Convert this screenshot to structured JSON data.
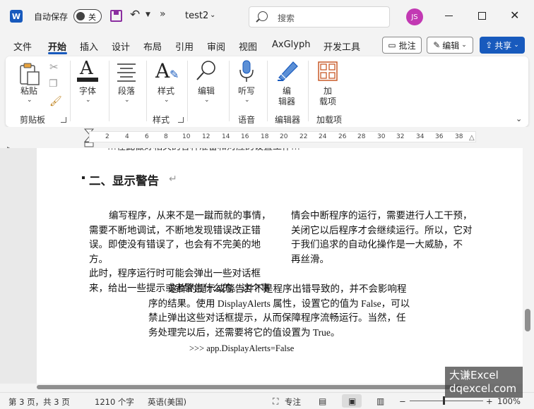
{
  "titlebar": {
    "app_letter": "W",
    "autosave_label": "自动保存",
    "autosave_state": "关",
    "doc_title": "test2",
    "search_placeholder": "搜索",
    "avatar_initials": "JS",
    "more": "»"
  },
  "menu": {
    "tabs": [
      "文件",
      "开始",
      "插入",
      "设计",
      "布局",
      "引用",
      "审阅",
      "视图",
      "AxGlyph",
      "开发工具"
    ],
    "active_tab": "开始",
    "comment_label": "批注",
    "edit_label": "编辑",
    "share_label": "共享"
  },
  "ribbon": {
    "paste_label": "粘贴",
    "clipboard_group": "剪贴板",
    "font_label": "字体",
    "paragraph_label": "段落",
    "styles_label": "样式",
    "styles_group": "样式",
    "editing_label": "编辑",
    "dictate_label": "听写",
    "voice_group": "语音",
    "editor_label_1": "编",
    "editor_label_2": "辑器",
    "editor_group": "编辑器",
    "addins_label_1": "加",
    "addins_label_2": "载项",
    "addins_group": "加载项"
  },
  "ruler_ticks": [
    "2",
    "4",
    "6",
    "8",
    "10",
    "12",
    "14",
    "16",
    "18",
    "20",
    "22",
    "24",
    "26",
    "28",
    "30",
    "32",
    "34",
    "36",
    "38"
  ],
  "document": {
    "cut_line": "…在此做好相关的各种准备和对应的设置工作…",
    "heading": "二、显示警告",
    "left_col": [
      "编写程序，从来不是一蹴而就的事情，",
      "需要不断地调试，不断地发现错误改正错",
      "误。即使没有错误了，也会有不完美的地方。",
      "此时，程序运行时可能会弹出一些对话框",
      "来，给出一些提示或者警告什么的。这个事"
    ],
    "right_col": [
      "情会中断程序的运行，需要进行人工干预，",
      "关闭它以后程序才会继续运行。所以，它对",
      "于我们追求的自动化操作是一大威胁，不",
      "再丝滑。"
    ],
    "center_block": [
      "这样的提示或警告并不是程序出错导致的，并不会影响程",
      "序的结果。使用 DisplayAlerts 属性，设置它的值为 False，可以",
      "禁止弹出这些对话框提示，从而保障程序流畅运行。当然，任",
      "务处理完以后，还需要将它的值设置为 True。"
    ],
    "code_line": ">>> app.DisplayAlerts=False"
  },
  "status": {
    "page_info": "第 3 页，共 3 页",
    "word_count": "1210 个字",
    "language": "英语(美国)",
    "focus": "专注",
    "zoom": "100%"
  },
  "watermark": {
    "line1": "大谦Excel",
    "line2": "dqexcel.com"
  }
}
